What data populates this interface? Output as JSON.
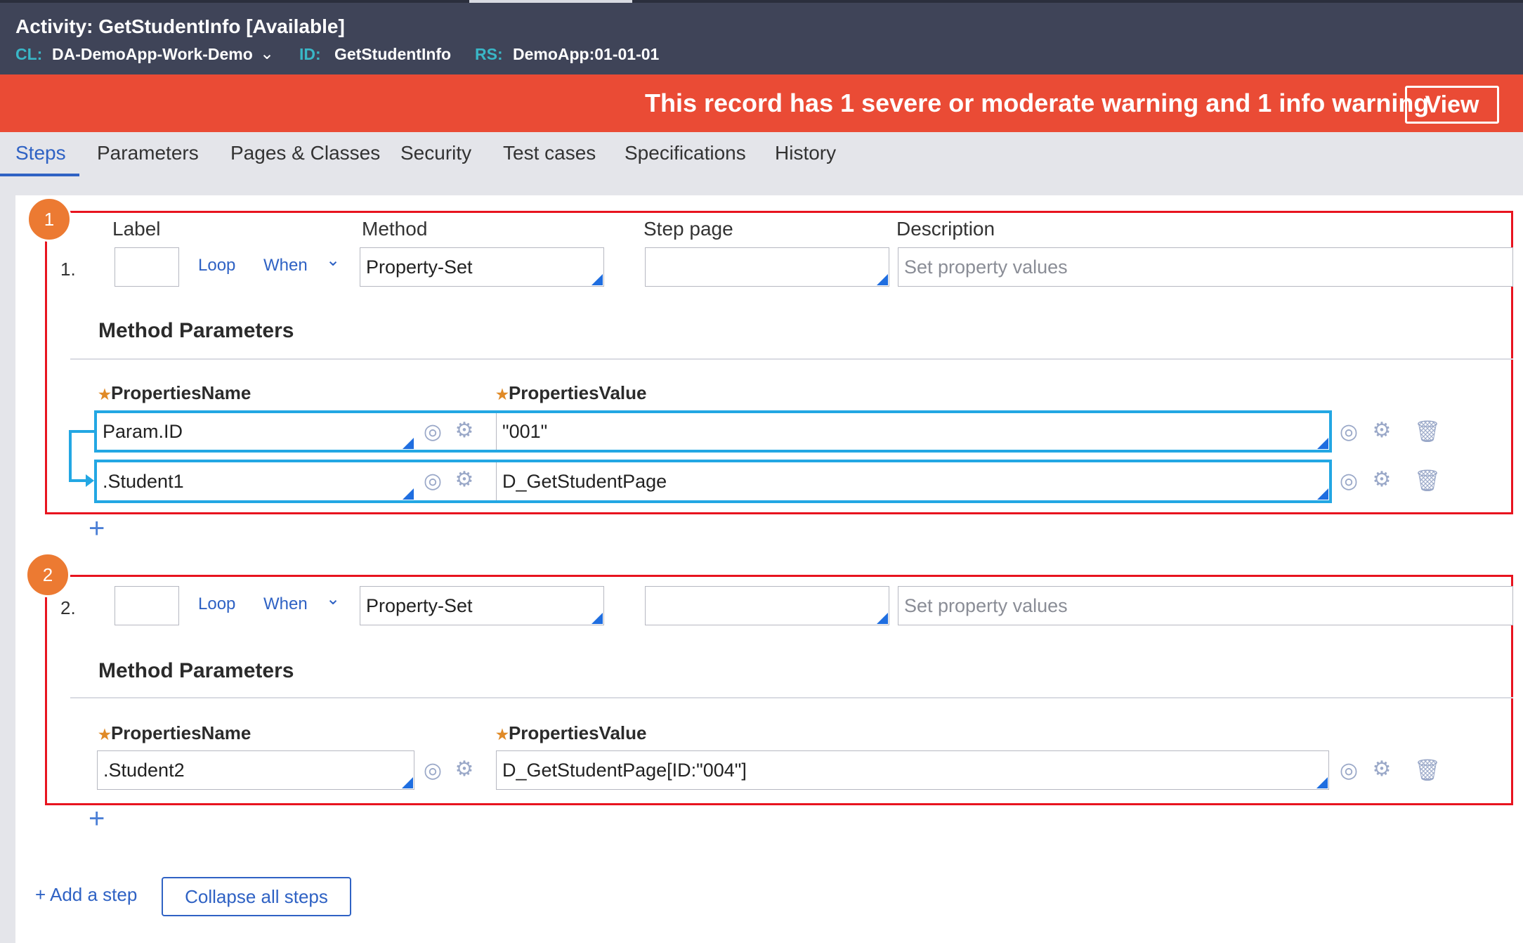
{
  "header": {
    "title": "Activity: GetStudentInfo [Available]",
    "cl_label": "CL:",
    "cl_value": "DA-DemoApp-Work-Demo",
    "id_label": "ID:",
    "id_value": "GetStudentInfo",
    "rs_label": "RS:",
    "rs_value": "DemoApp:01-01-01"
  },
  "banner": {
    "text": "This record has 1 severe or moderate warning and 1 info warning",
    "view_label": "View"
  },
  "tabs": [
    {
      "label": "Steps",
      "active": true
    },
    {
      "label": "Parameters"
    },
    {
      "label": "Pages & Classes"
    },
    {
      "label": "Security"
    },
    {
      "label": "Test cases"
    },
    {
      "label": "Specifications"
    },
    {
      "label": "History"
    }
  ],
  "columns": {
    "label": "Label",
    "method": "Method",
    "step_page": "Step page",
    "description": "Description"
  },
  "steps": [
    {
      "badge": "1",
      "number": "1.",
      "loop": "Loop",
      "when": "When",
      "label_value": "",
      "method": "Property-Set",
      "step_page": "",
      "description_placeholder": "Set property values",
      "section_title": "Method Parameters",
      "name_header": "PropertiesName",
      "value_header": "PropertiesValue",
      "rows": [
        {
          "name": "Param.ID",
          "value": "\"001\""
        },
        {
          "name": ".Student1",
          "value": "D_GetStudentPage"
        }
      ]
    },
    {
      "badge": "2",
      "number": "2.",
      "loop": "Loop",
      "when": "When",
      "label_value": "",
      "method": "Property-Set",
      "step_page": "",
      "description_placeholder": "Set property values",
      "section_title": "Method Parameters",
      "name_header": "PropertiesName",
      "value_header": "PropertiesValue",
      "rows": [
        {
          "name": ".Student2",
          "value": "D_GetStudentPage[ID:\"004\"]"
        }
      ]
    }
  ],
  "footer": {
    "add_step": "+ Add a step",
    "collapse_all": "Collapse all steps"
  },
  "icons": {
    "target": "target-icon",
    "gear": "gear-icon",
    "trash": "trash-icon",
    "plus": "plus-icon"
  },
  "colors": {
    "header_bg": "#3f4458",
    "banner_bg": "#ea4b35",
    "accent": "#2f62c4",
    "highlight_red": "#e8141f",
    "highlight_blue": "#23a7e3",
    "badge": "#ec7a32"
  }
}
